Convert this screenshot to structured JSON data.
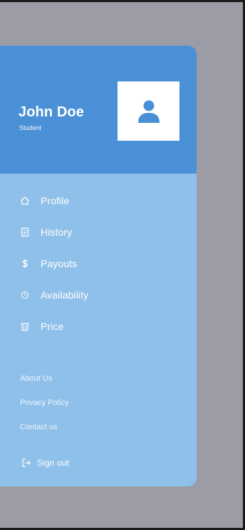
{
  "colors": {
    "backdrop": "#9b9ca5",
    "drawer": "#8fc0ea",
    "header": "#4a90d6",
    "text": "#ffffff",
    "avatar_icon": "#4a90d6"
  },
  "user": {
    "name": "John Doe",
    "role": "Student",
    "avatar_icon": "user-icon"
  },
  "nav": {
    "items": [
      {
        "label": "Profile",
        "icon": "home-icon"
      },
      {
        "label": "History",
        "icon": "receipt-icon"
      },
      {
        "label": "Payouts",
        "icon": "dollar-icon"
      },
      {
        "label": "Availability",
        "icon": "clock-icon"
      },
      {
        "label": "Price",
        "icon": "bucket-icon"
      }
    ]
  },
  "footer": {
    "links": [
      {
        "label": "About Us"
      },
      {
        "label": "Privacy Policy"
      },
      {
        "label": "Contact us"
      }
    ],
    "signout": {
      "label": "Sign out",
      "icon": "logout-icon"
    }
  }
}
